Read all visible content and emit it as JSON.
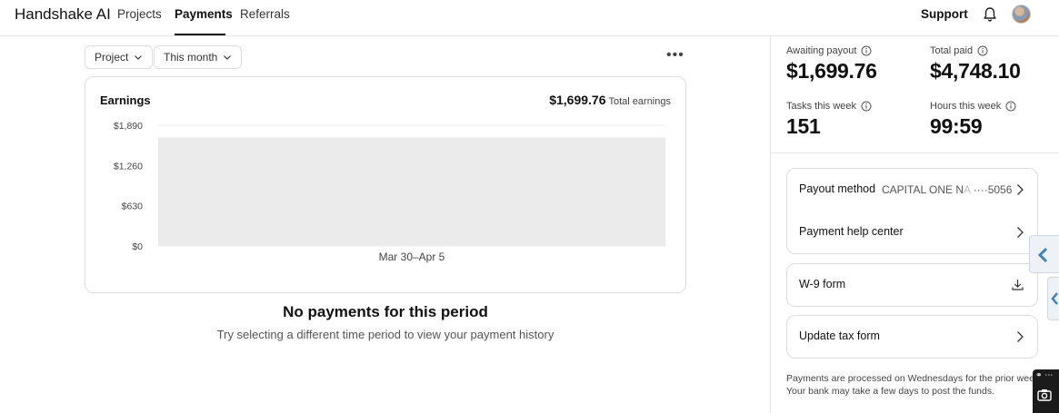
{
  "nav": {
    "brand": "Handshake AI",
    "links": [
      "Projects",
      "Payments",
      "Referrals"
    ],
    "active": "Payments",
    "support": "Support"
  },
  "filters": {
    "project": "Project",
    "period": "This month"
  },
  "earnings_card": {
    "title": "Earnings",
    "total_value": "$1,699.76",
    "total_label": "Total earnings"
  },
  "chart_data": {
    "type": "bar",
    "categories": [
      "Mar 30–Apr 5"
    ],
    "values": [
      1699.76
    ],
    "y_ticks": [
      "$1,890",
      "$1,260",
      "$630",
      "$0"
    ],
    "y_tick_values": [
      1890,
      1260,
      630,
      0
    ],
    "ylim": [
      0,
      1890
    ],
    "grid": true,
    "bar_color": "#ebebeb",
    "grid_color": "#ececec"
  },
  "empty_state": {
    "title": "No payments for this period",
    "subtitle": "Try selecting a different time period to view your payment history"
  },
  "stats": {
    "awaiting_payout": {
      "label": "Awaiting payout",
      "value": "$1,699.76"
    },
    "total_paid": {
      "label": "Total paid",
      "value": "$4,748.10"
    },
    "tasks_this_week": {
      "label": "Tasks this week",
      "value": "151"
    },
    "hours_this_week": {
      "label": "Hours this week",
      "value": "99:59"
    }
  },
  "payout": {
    "method_label": "Payout method",
    "bank_name": "CAPITAL ONE N",
    "bank_name_faded": "A",
    "account_suffix": "····5056",
    "help_center": "Payment help center",
    "w9": "W-9 form",
    "update_tax": "Update tax form"
  },
  "footnote": {
    "line1": "Payments are processed on Wednesdays for the prior wee",
    "line2": "Your bank may take a few days to post the funds."
  },
  "colors": {
    "accent_blue": "#3b82c4",
    "border": "#dddddd",
    "text": "#111111"
  }
}
